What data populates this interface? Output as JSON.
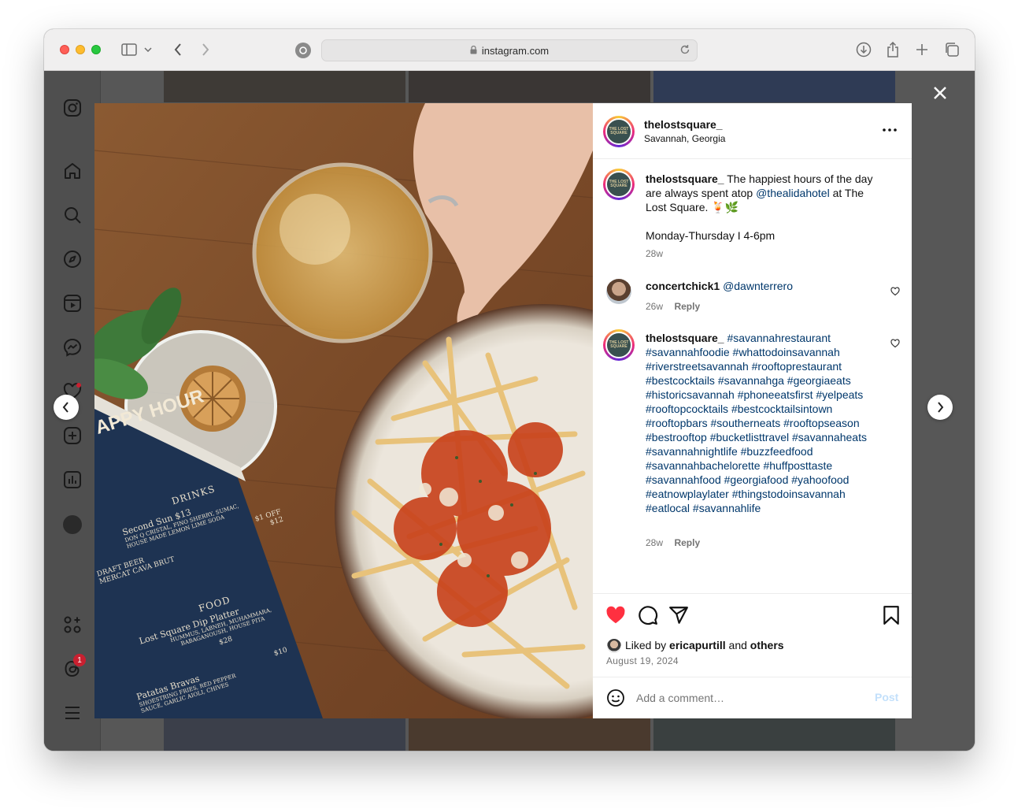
{
  "browser": {
    "url": "instagram.com"
  },
  "post": {
    "account": "thelostsquare_",
    "location": "Savannah, Georgia",
    "avatar_text": "THE LOST SQUARE",
    "caption": {
      "username": "thelostsquare_",
      "text_before_mention": "The happiest hours of the day are always spent atop",
      "mention": "@thealidahotel",
      "text_after_mention": "at The Lost Square. 🍹🌿",
      "schedule": "Monday-Thursday I 4-6pm",
      "age": "28w"
    },
    "comments": [
      {
        "username": "concertchick1",
        "text": "@dawnterrero",
        "age": "26w",
        "reply_label": "Reply"
      },
      {
        "username": "thelostsquare_",
        "hashtags": "#savannahrestaurant #savannahfoodie #whattodoinsavannah #riverstreetsavannah #rooftoprestaurant #bestcocktails #savannahga #georgiaeats #historicsavannah #phoneeatsfirst #yelpeats #rooftopcocktails #bestcocktailsintown #rooftopbars #southerneats #rooftopseason #bestrooftop #bucketlisttravel #savannaheats #savannahnightlife #buzzfeedfood #savannahbachelorette #huffposttaste #savannahfood #georgiafood #yahoofood #eatnowplaylater #thingstodoinsavannah #eatlocal #savannahlife",
        "age": "28w",
        "reply_label": "Reply"
      }
    ],
    "likes": {
      "prefix": "Liked by",
      "user": "ericapurtill",
      "joiner": "and",
      "others": "others"
    },
    "date": "August 19, 2024",
    "add_comment_placeholder": "Add a comment…",
    "post_button": "Post",
    "liked": true
  },
  "photo_menu": {
    "heading": "APPY HOUR",
    "drinks_heading": "DRINKS",
    "drinks_line1": "Second Sun $13",
    "drinks_line2": "DON Q CRISTAL, FINO SHERRY, SUMAC,",
    "drinks_line3": "HOUSE MADE LEMON LIME SODA",
    "off": "$1 OFF",
    "draft": "DRAFT BEER",
    "cava": "MERCAT CAVA BRUT",
    "cava_price": "$12",
    "food_heading": "FOOD",
    "dip": "Lost Square Dip Platter",
    "dip_desc1": "HUMMUS, LABNEH, MUHAMMARA,",
    "dip_desc2": "BABAGANOUSH, HOUSE PITA",
    "dip_price": "$28",
    "bravas": "Patatas Bravas",
    "bravas_price": "$10",
    "bravas_desc1": "SHOESTRING FRIES, RED PEPPER",
    "bravas_desc2": "SAUCE, GARLIC AIOLI, CHIVES"
  },
  "colors": {
    "heart_liked": "#ff3040",
    "link": "#00376b",
    "post_disabled": "#c3e0fb"
  },
  "sidebar": {
    "notification_badge": "1"
  }
}
